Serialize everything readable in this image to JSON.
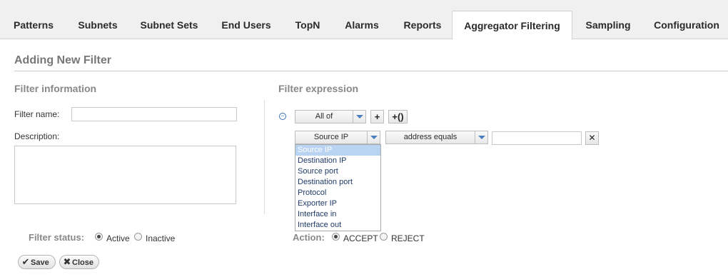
{
  "tabs": [
    {
      "label": "Patterns",
      "active": false
    },
    {
      "label": "Subnets",
      "active": false
    },
    {
      "label": "Subnet Sets",
      "active": false
    },
    {
      "label": "End Users",
      "active": false
    },
    {
      "label": "TopN",
      "active": false
    },
    {
      "label": "Alarms",
      "active": false
    },
    {
      "label": "Reports",
      "active": false
    },
    {
      "label": "Aggregator Filtering",
      "active": true
    },
    {
      "label": "Sampling",
      "active": false
    },
    {
      "label": "Configuration",
      "active": false
    }
  ],
  "page_title": "Adding New Filter",
  "filter_info": {
    "title": "Filter information",
    "name_label": "Filter name:",
    "name_value": "",
    "description_label": "Description:",
    "description_value": ""
  },
  "filter_status": {
    "label": "Filter status:",
    "options": [
      {
        "label": "Active",
        "checked": true
      },
      {
        "label": "Inactive",
        "checked": false
      }
    ]
  },
  "buttons": {
    "save": "Save",
    "close": "Close"
  },
  "expression": {
    "title": "Filter expression",
    "toggle": "⊖",
    "group_select": "All of",
    "add_label": "+",
    "add_group_label": "+()",
    "field_select": "Source IP",
    "operator_select": "address equals",
    "value": "",
    "remove_label": "✕",
    "field_options": [
      "Source IP",
      "Destination IP",
      "Source port",
      "Destination port",
      "Protocol",
      "Exporter IP",
      "Interface in",
      "Interface out"
    ],
    "selected_option_index": 0
  },
  "action": {
    "label": "Action:",
    "options": [
      {
        "label": "ACCEPT",
        "checked": true
      },
      {
        "label": "REJECT",
        "checked": false
      }
    ]
  }
}
